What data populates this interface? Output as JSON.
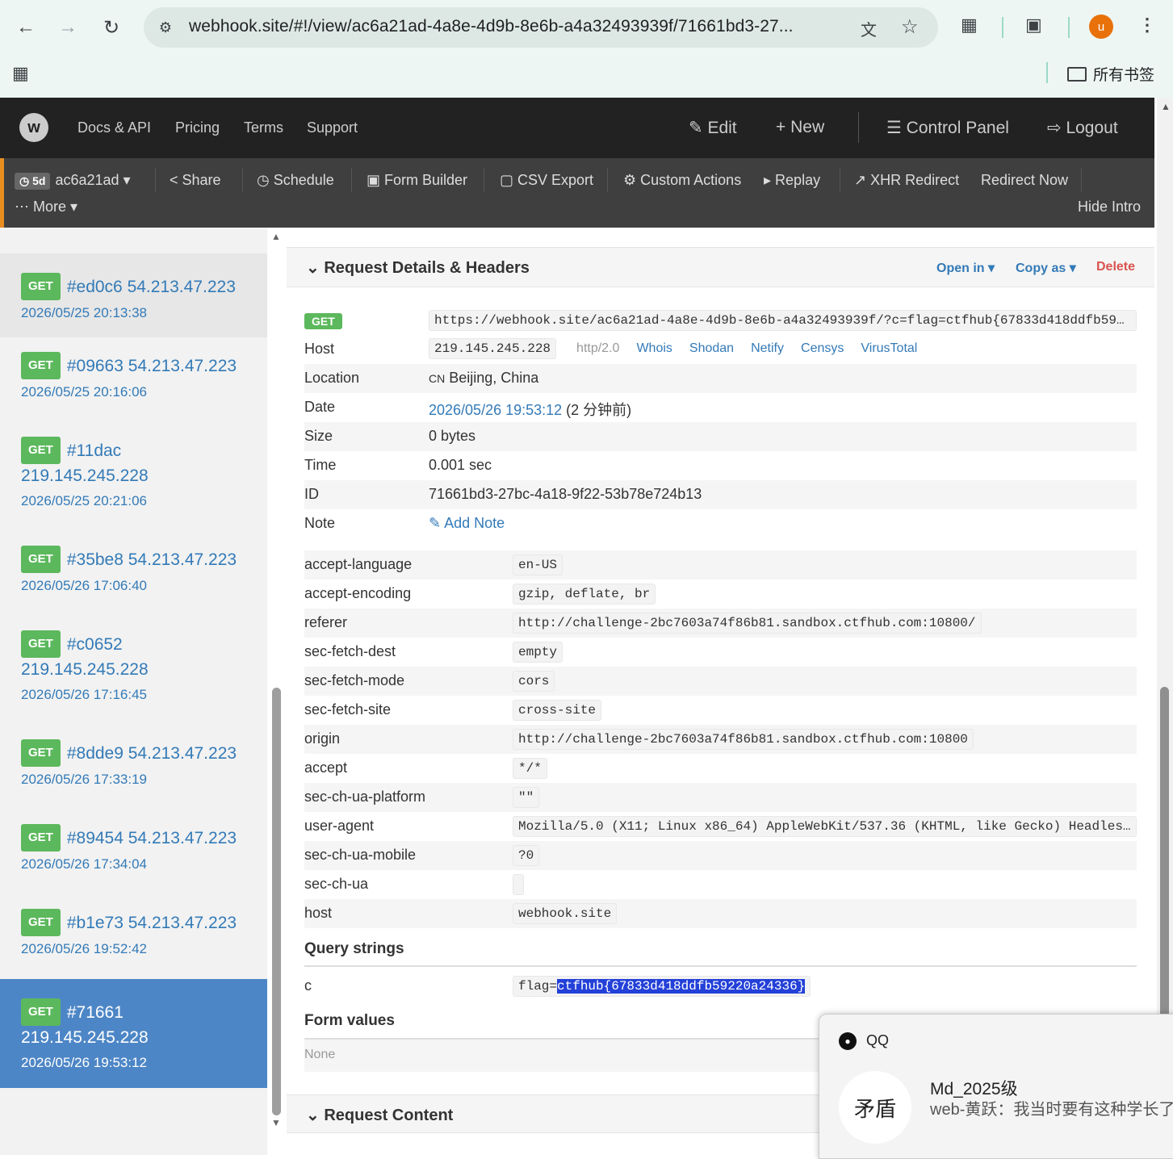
{
  "browser": {
    "url": "webhook.site/#!/view/ac6a21ad-4a8e-4d9b-8e6b-a4a32493939f/71661bd3-27...",
    "avatar_letter": "u",
    "bookmarks_label": "所有书签"
  },
  "topnav": {
    "links": [
      "Docs & API",
      "Pricing",
      "Terms",
      "Support"
    ],
    "edit": "Edit",
    "new": "New",
    "control_panel": "Control Panel",
    "logout": "Logout"
  },
  "toolbar": {
    "age_badge": "5d",
    "token": "ac6a21ad",
    "share": "Share",
    "schedule": "Schedule",
    "form_builder": "Form Builder",
    "csv_export": "CSV Export",
    "custom_actions": "Custom Actions",
    "replay": "Replay",
    "xhr_redirect": "XHR Redirect",
    "redirect_now": "Redirect Now",
    "more": "More",
    "hide_intro": "Hide Intro"
  },
  "requests": [
    {
      "method": "GET",
      "id": "#ed0c6 54.213.47.223",
      "time": "2026/05/25 20:13:38"
    },
    {
      "method": "GET",
      "id": "#09663 54.213.47.223",
      "time": "2026/05/25 20:16:06"
    },
    {
      "method": "GET",
      "id": "#11dac",
      "ip": "219.145.245.228",
      "time": "2026/05/25 20:21:06"
    },
    {
      "method": "GET",
      "id": "#35be8 54.213.47.223",
      "time": "2026/05/26 17:06:40"
    },
    {
      "method": "GET",
      "id": "#c0652",
      "ip": "219.145.245.228",
      "time": "2026/05/26 17:16:45"
    },
    {
      "method": "GET",
      "id": "#8dde9 54.213.47.223",
      "time": "2026/05/26 17:33:19"
    },
    {
      "method": "GET",
      "id": "#89454 54.213.47.223",
      "time": "2026/05/26 17:34:04"
    },
    {
      "method": "GET",
      "id": "#b1e73 54.213.47.223",
      "time": "2026/05/26 19:52:42"
    },
    {
      "method": "GET",
      "id": "#71661",
      "ip": "219.145.245.228",
      "time": "2026/05/26 19:53:12"
    }
  ],
  "details": {
    "title": "Request Details & Headers",
    "open_in": "Open in",
    "copy_as": "Copy as",
    "delete": "Delete",
    "method": "GET",
    "full_url": "https://webhook.site/ac6a21ad-4a8e-4d9b-8e6b-a4a32493939f/?c=flag=ctfhub{67833d418ddfb5922...",
    "host_label": "Host",
    "host_ip": "219.145.245.228",
    "protocol": "http/2.0",
    "host_links": [
      "Whois",
      "Shodan",
      "Netify",
      "Censys",
      "VirusTotal"
    ],
    "location_label": "Location",
    "country_code": "CN",
    "location": "Beijing, China",
    "date_label": "Date",
    "date": "2026/05/26 19:53:12",
    "date_relative": "(2 分钟前)",
    "size_label": "Size",
    "size": "0 bytes",
    "time_label": "Time",
    "time": "0.001 sec",
    "id_label": "ID",
    "id": "71661bd3-27bc-4a18-9f22-53b78e724b13",
    "note_label": "Note",
    "add_note": "Add Note"
  },
  "headers": [
    {
      "k": "accept-language",
      "v": "en-US"
    },
    {
      "k": "accept-encoding",
      "v": "gzip, deflate, br"
    },
    {
      "k": "referer",
      "v": "http://challenge-2bc7603a74f86b81.sandbox.ctfhub.com:10800/"
    },
    {
      "k": "sec-fetch-dest",
      "v": "empty"
    },
    {
      "k": "sec-fetch-mode",
      "v": "cors"
    },
    {
      "k": "sec-fetch-site",
      "v": "cross-site"
    },
    {
      "k": "origin",
      "v": "http://challenge-2bc7603a74f86b81.sandbox.ctfhub.com:10800"
    },
    {
      "k": "accept",
      "v": "*/*"
    },
    {
      "k": "sec-ch-ua-platform",
      "v": "\"\""
    },
    {
      "k": "user-agent",
      "v": "Mozilla/5.0 (X11; Linux x86_64) AppleWebKit/537.36 (KHTML, like Gecko) Headless..."
    },
    {
      "k": "sec-ch-ua-mobile",
      "v": "?0"
    },
    {
      "k": "sec-ch-ua",
      "v": ""
    },
    {
      "k": "host",
      "v": "webhook.site"
    }
  ],
  "query": {
    "title": "Query strings",
    "key": "c",
    "value_prefix": "flag=",
    "value_highlight": "ctfhub{67833d418ddfb59220a24336}"
  },
  "form_values": {
    "title": "Form values",
    "value": "None"
  },
  "request_content": {
    "title": "Request Content"
  },
  "notification": {
    "app": "QQ",
    "sender": "Md_2025级",
    "message": "web-黄跃：我当时要有这种学长了",
    "avatar_text": "矛盾"
  }
}
